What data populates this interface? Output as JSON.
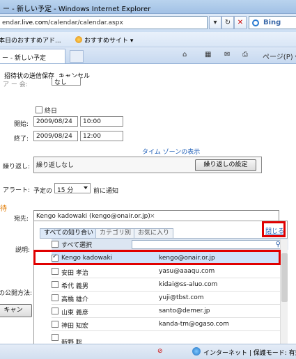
{
  "window": {
    "title": "ー - 新しい予定 - Windows Internet Explorer"
  },
  "address": {
    "url_prefix": "endar.",
    "url_domain": "live.com",
    "url_path": "/calendar/calendar.aspx",
    "refresh_label": "⁴₇",
    "stop_label": "✕"
  },
  "search": {
    "engine": "Bing"
  },
  "favorites": {
    "items": [
      {
        "label": "本日のおすすめアド..."
      },
      {
        "label": "おすすめサイト ▾"
      }
    ]
  },
  "tab": {
    "label": "ー - 新しい予定"
  },
  "toolbar": {
    "page_label": "ページ(P) ▾",
    "home": "⌂",
    "feeds": "▦",
    "mail": "✉",
    "print": "⎙"
  },
  "commands": [
    {
      "label": "招待状の送信"
    },
    {
      "label": "保存"
    },
    {
      "label": "キャンセル"
    }
  ],
  "form": {
    "partial_top": "ア  ー  会:",
    "partial_top_value": "なし",
    "allday_label": "終日",
    "start_label": "開始:",
    "start_date": "2009/08/24",
    "start_time": "10:00",
    "end_label": "終了:",
    "end_date": "2009/08/24",
    "end_time": "12:00",
    "timezone_link": "タイム ゾーンの表示",
    "repeat_label": "繰り返し:",
    "repeat_value": "繰り返しなし",
    "repeat_button": "繰り返しの設定",
    "alert_label": "アラート:",
    "alert_prefix": "予定の",
    "alert_value": "15 分",
    "alert_suffix": "前に通知",
    "invite_section": "待",
    "to_label": "宛先:",
    "to_value": "Kengo kadowaki (kengo@onair.or.jp)",
    "to_remove": "×",
    "desc_label": "説明:",
    "public_label": "の公開方法:",
    "cancel_partial": "キャン"
  },
  "picker": {
    "tabs": [
      {
        "label": "すべての知り合い"
      },
      {
        "label": "カテゴリ別"
      },
      {
        "label": "お気に入り"
      }
    ],
    "close_link": "閉じる",
    "select_all": "すべて選択",
    "contacts": [
      {
        "name": "Kengo kadowaki",
        "email": "kengo@onair.or.jp",
        "checked": true
      },
      {
        "name": "安田 孝治",
        "email": "yasu@aaaqu.com",
        "checked": false
      },
      {
        "name": "希代 義男",
        "email": "kidai@ss-aluo.com",
        "checked": false
      },
      {
        "name": "高橋 雄介",
        "email": "yuji@tbst.com",
        "checked": false
      },
      {
        "name": "山東 義彦",
        "email": "santo@demer.jp",
        "checked": false
      },
      {
        "name": "神田 知宏",
        "email": "kanda-tm@ogaso.com",
        "checked": false
      },
      {
        "name": "新野 聡",
        "email": "",
        "checked": false
      }
    ]
  },
  "status": {
    "zone": "インターネット | 保護モード: 有効"
  }
}
